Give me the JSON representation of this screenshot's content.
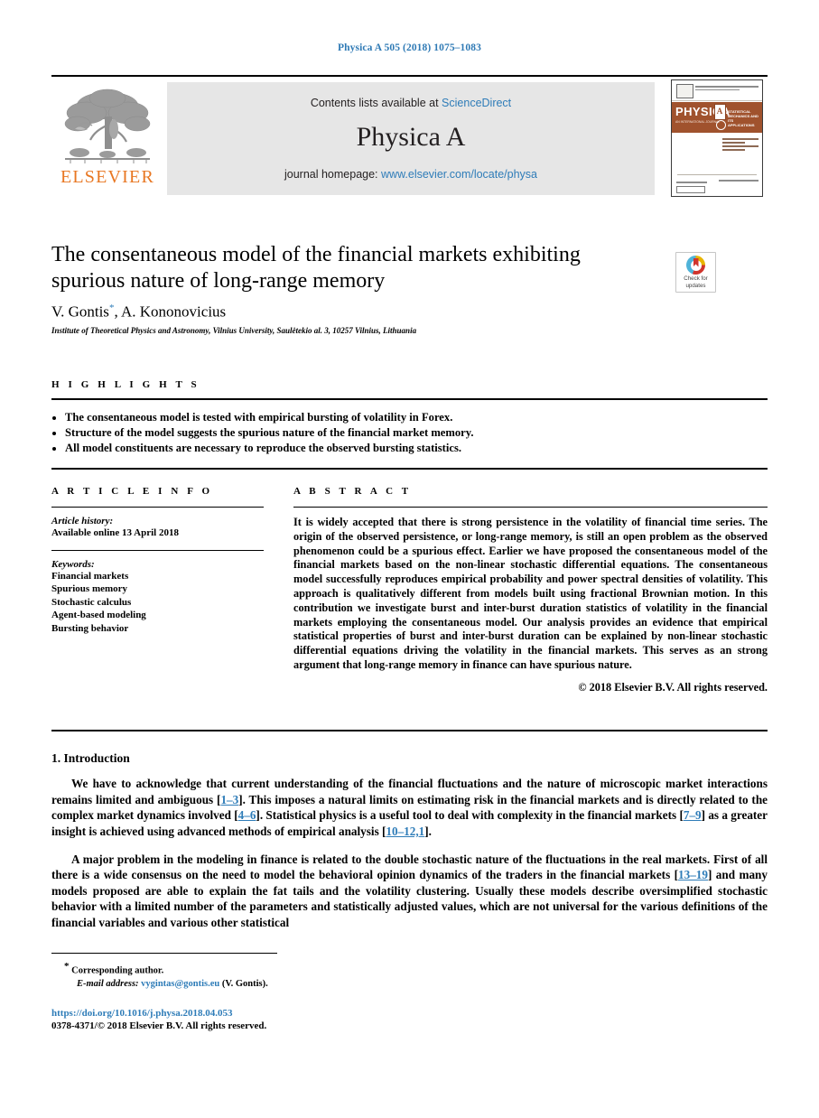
{
  "running_head": "Physica A 505 (2018) 1075–1083",
  "masthead": {
    "contents_prefix": "Contents lists available at",
    "contents_link": "ScienceDirect",
    "journal_title": "Physica A",
    "homepage_prefix": "journal homepage:",
    "homepage_link": "www.elsevier.com/locate/physa",
    "publisher": "ELSEVIER",
    "cover": {
      "brand": "PHYSICA",
      "volume_letter": "A",
      "subtitle": "STATISTICAL MECHANICS AND ITS APPLICATIONS",
      "brand_sub": "AN INTERNATIONAL JOURNAL"
    }
  },
  "article": {
    "title": "The consentaneous model of the financial markets exhibiting spurious nature of long-range memory",
    "authors": "V. Gontis",
    "authors_rest": ", A. Kononovicius",
    "corresponding_marker": "*",
    "affiliation": "Institute of Theoretical Physics and Astronomy, Vilnius University, Saulėtekio al. 3, 10257 Vilnius, Lithuania"
  },
  "crossmark": {
    "line1": "Check for",
    "line2": "updates"
  },
  "highlights": {
    "label": "H I G H L I G H T S",
    "items": [
      "The consentaneous model is tested with empirical bursting of volatility in Forex.",
      "Structure of the model suggests the spurious nature of the financial market memory.",
      "All model constituents are necessary to reproduce the observed bursting statistics."
    ]
  },
  "article_info": {
    "label": "A R T I C L E    I N F O",
    "history_label": "Article history:",
    "history_value": "Available online 13 April 2018",
    "keywords_label": "Keywords:",
    "keywords": [
      "Financial markets",
      "Spurious memory",
      "Stochastic calculus",
      "Agent-based modeling",
      "Bursting behavior"
    ]
  },
  "abstract": {
    "label": "A B S T R A C T",
    "text": "It is widely accepted that there is strong persistence in the volatility of financial time series. The origin of the observed persistence, or long-range memory, is still an open problem as the observed phenomenon could be a spurious effect. Earlier we have proposed the consentaneous model of the financial markets based on the non-linear stochastic differential equations. The consentaneous model successfully reproduces empirical probability and power spectral densities of volatility. This approach is qualitatively different from models built using fractional Brownian motion. In this contribution we investigate burst and inter-burst duration statistics of volatility in the financial markets employing the consentaneous model. Our analysis provides an evidence that empirical statistical properties of burst and inter-burst duration can be explained by non-linear stochastic differential equations driving the volatility in the financial markets. This serves as an strong argument that long-range memory in finance can have spurious nature.",
    "copyright": "© 2018 Elsevier B.V. All rights reserved."
  },
  "introduction": {
    "heading": "1.  Introduction",
    "paragraph1_a": "We have to acknowledge that current understanding of the financial fluctuations and the nature of microscopic market interactions remains limited and ambiguous [",
    "p1_ref1": "1–3",
    "paragraph1_b": "]. This imposes a natural limits on estimating risk in the financial markets and is directly related to the complex market dynamics involved [",
    "p1_ref2": "4–6",
    "paragraph1_c": "]. Statistical physics is a useful tool to deal with complexity in the financial markets [",
    "p1_ref3": "7–9",
    "paragraph1_d": "] as a greater insight is achieved using advanced methods of empirical analysis [",
    "p1_ref4": "10–12,1",
    "paragraph1_e": "].",
    "paragraph2_a": "A major problem in the modeling in finance is related to the double stochastic nature of the fluctuations in the real markets. First of all there is a wide consensus on the need to model the behavioral opinion dynamics of the traders in the financial markets [",
    "p2_ref1": "13–19",
    "paragraph2_b": "] and many models proposed are able to explain the fat tails and the volatility clustering. Usually these models describe oversimplified stochastic behavior with a limited number of the parameters and statistically adjusted values, which are not universal for the various definitions of the financial variables and various other statistical"
  },
  "footer": {
    "corresponding_marker": "*",
    "corresponding_text": "Corresponding author.",
    "email_label": "E-mail address:",
    "email": "vygintas@gontis.eu",
    "email_suffix": "(V. Gontis).",
    "doi": "https://doi.org/10.1016/j.physa.2018.04.053",
    "issn_line": "0378-4371/© 2018 Elsevier B.V. All rights reserved."
  },
  "colors": {
    "link_blue": "#2e7cb8",
    "elsevier_orange": "#e87722",
    "panel_gray": "#e6e6e6",
    "cover_brown": "#a0522d"
  }
}
